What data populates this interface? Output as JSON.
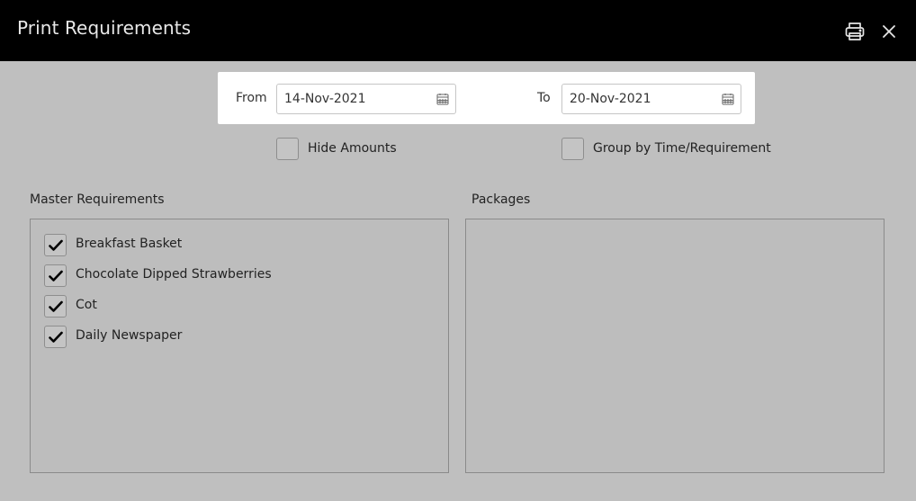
{
  "header": {
    "title": "Print Requirements",
    "print_icon": "printer-icon",
    "close_icon": "close-icon"
  },
  "date_range": {
    "from_label": "From",
    "from_value": "14-Nov-2021",
    "to_label": "To",
    "to_value": "20-Nov-2021",
    "calendar_icon": "calendar-icon"
  },
  "options": {
    "hide_amounts": {
      "label": "Hide Amounts",
      "checked": false
    },
    "group_by": {
      "label": "Group by Time/Requirement",
      "checked": false
    }
  },
  "master_requirements": {
    "title": "Master Requirements",
    "items": [
      {
        "label": "Breakfast Basket",
        "checked": true
      },
      {
        "label": "Chocolate Dipped Strawberries",
        "checked": true
      },
      {
        "label": "Cot",
        "checked": true
      },
      {
        "label": "Daily Newspaper",
        "checked": true
      }
    ]
  },
  "packages": {
    "title": "Packages",
    "items": []
  }
}
